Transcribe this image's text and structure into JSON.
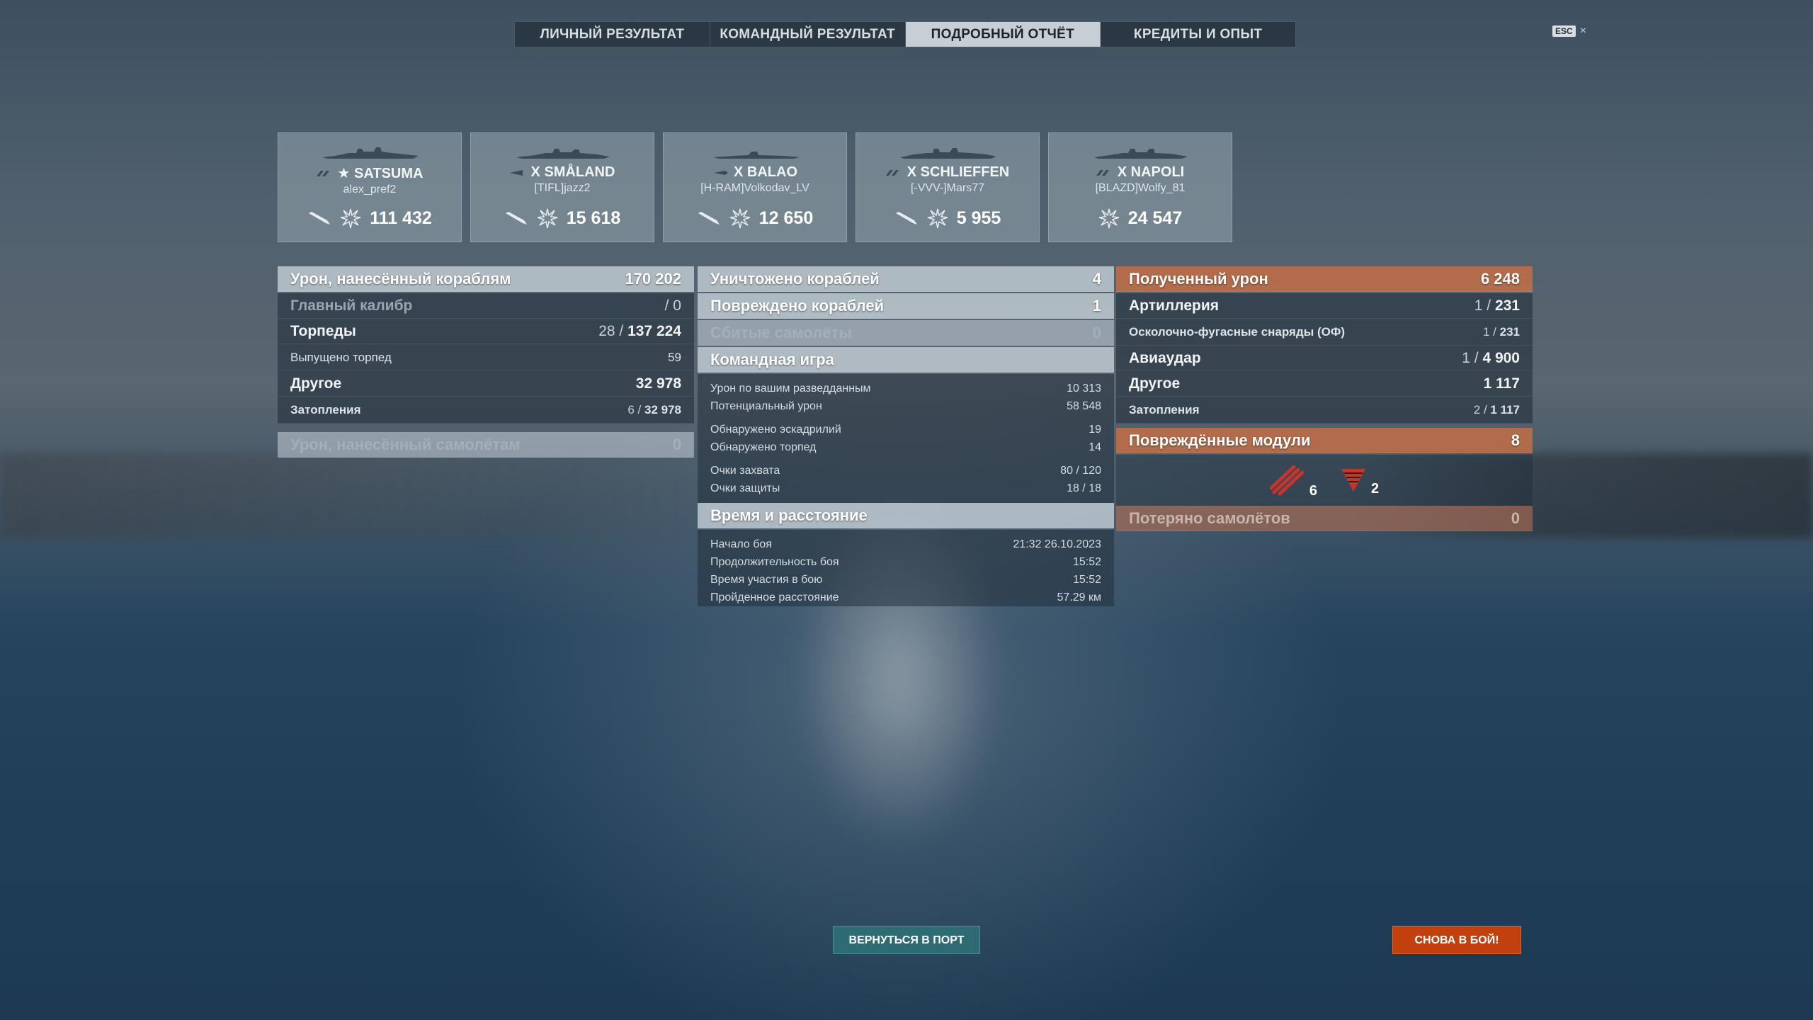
{
  "tabs": [
    {
      "label": "ЛИЧНЫЙ РЕЗУЛЬТАТ",
      "active": false
    },
    {
      "label": "КОМАНДНЫЙ РЕЗУЛЬТАТ",
      "active": false
    },
    {
      "label": "ПОДРОБНЫЙ ОТЧЁТ",
      "active": true
    },
    {
      "label": "КРЕДИТЫ И ОПЫТ",
      "active": false
    }
  ],
  "close": {
    "key": "ESC",
    "icon": "×"
  },
  "ships": [
    {
      "tier_mark": "★",
      "name": "SATSUMA",
      "player": "alex_pref2",
      "damage": "111 432",
      "has_torpedo": true
    },
    {
      "tier_mark": "X",
      "name": "SMÅLAND",
      "player": "[TIFL]jazz2",
      "damage": "15 618",
      "has_torpedo": true
    },
    {
      "tier_mark": "X",
      "name": "BALAO",
      "player": "[H-RAM]Volkodav_LV",
      "damage": "12 650",
      "has_torpedo": true
    },
    {
      "tier_mark": "X",
      "name": "SCHLIEFFEN",
      "player": "[-VVV-]Mars77",
      "damage": "5 955",
      "has_torpedo": true
    },
    {
      "tier_mark": "X",
      "name": "NAPOLI",
      "player": "[BLAZD]Wolfy_81",
      "damage": "24 547",
      "has_torpedo": false
    }
  ],
  "damage_dealt": {
    "title": "Урон, нанесённый кораблям",
    "total": "170 202",
    "main_caliber": {
      "label": "Главный калибр",
      "value": "/ 0"
    },
    "torpedoes": {
      "label": "Торпеды",
      "hits": "28",
      "value": "137 224"
    },
    "torpedoes_fired": {
      "label": "Выпущено торпед",
      "value": "59"
    },
    "other": {
      "label": "Другое",
      "value": "32 978"
    },
    "flooding": {
      "label": "Затопления",
      "hits": "6",
      "value": "32 978"
    },
    "planes": {
      "label": "Урон, нанесённый самолётам",
      "value": "0"
    }
  },
  "center": {
    "destroyed": {
      "label": "Уничтожено кораблей",
      "value": "4"
    },
    "damaged": {
      "label": "Повреждено кораблей",
      "value": "1"
    },
    "planes_shot": {
      "label": "Сбитые самолёты",
      "value": "0"
    },
    "team_play": {
      "title": "Командная игра",
      "rows": [
        {
          "label": "Урон по вашим разведданным",
          "value": "10 313"
        },
        {
          "label": "Потенциальный урон",
          "value": "58 548"
        },
        {
          "label": "Обнаружено эскадрилий",
          "value": "19"
        },
        {
          "label": "Обнаружено торпед",
          "value": "14"
        },
        {
          "label": "Очки захвата",
          "value": "80 / 120"
        },
        {
          "label": "Очки защиты",
          "value": "18 / 18"
        }
      ]
    },
    "time": {
      "title": "Время и расстояние",
      "rows": [
        {
          "label": "Начало боя",
          "value": "21:32  26.10.2023"
        },
        {
          "label": "Продолжительность боя",
          "value": "15:52"
        },
        {
          "label": "Время участия в бою",
          "value": "15:52"
        },
        {
          "label": "Пройденное расстояние",
          "value": "57.29 км"
        }
      ]
    }
  },
  "received": {
    "title": "Полученный урон",
    "total": "6 248",
    "artillery": {
      "label": "Артиллерия",
      "hits": "1",
      "value": "231"
    },
    "he_shells": {
      "label": "Осколочно-фугасные снаряды (ОФ)",
      "hits": "1",
      "value": "231"
    },
    "airstrike": {
      "label": "Авиаудар",
      "hits": "1",
      "value": "4 900"
    },
    "other": {
      "label": "Другое",
      "value": "1 117"
    },
    "flooding": {
      "label": "Затопления",
      "hits": "2",
      "value": "1 117"
    },
    "modules": {
      "label": "Повреждённые модули",
      "value": "8",
      "torpedo_tubes": "6",
      "steering": "2"
    },
    "planes_lost": {
      "label": "Потеряно самолётов",
      "value": "0"
    }
  },
  "buttons": {
    "port": "ВЕРНУТЬСЯ В ПОРТ",
    "battle": "СНОВА В БОЙ!"
  }
}
